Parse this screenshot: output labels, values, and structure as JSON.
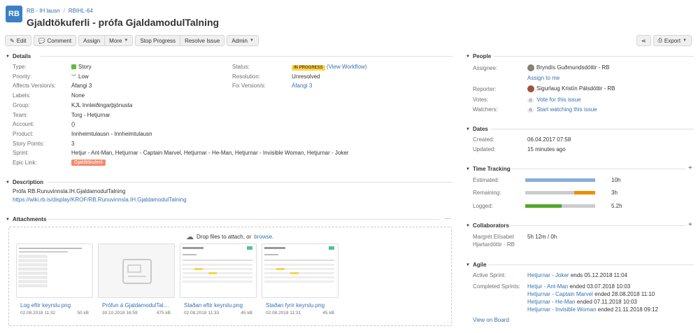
{
  "header": {
    "project_avatar": "RB",
    "breadcrumb_project": "RB - IH lausn",
    "breadcrumb_issue": "RBIHL-64",
    "title": "Gjaldtökuferli - prófa GjaldamodulTalning"
  },
  "toolbar": {
    "edit": "Edit",
    "comment": "Comment",
    "assign": "Assign",
    "more": "More",
    "stop_progress": "Stop Progress",
    "resolve_issue": "Resolve Issue",
    "admin": "Admin",
    "export": "Export"
  },
  "details": {
    "heading": "Details",
    "type_label": "Type:",
    "type_value": "Story",
    "priority_label": "Priority:",
    "priority_value": "Low",
    "affects_label": "Affects Version/s:",
    "affects_value": "Áfangi 3",
    "labels_label": "Labels:",
    "labels_value": "None",
    "group_label": "Group:",
    "group_value": "KJL Innleiðingarþjónusta",
    "team_label": "Team:",
    "team_value": "Torg - Hetjurnar",
    "account_label": "Account:",
    "account_value": "()",
    "product_label": "Product:",
    "product_value": "Innheimtulausn - Innheimtulausn",
    "points_label": "Story Points:",
    "points_value": "3",
    "sprint_label": "Sprint:",
    "sprint_value": "Hetjur - Ant-Man, Hetjurnar - Captain Marvel, Hetjurnar - He-Man, Hetjurnar - Invisible Woman, Hetjurnar - Joker",
    "epic_label": "Epic Link:",
    "epic_value": "Gjaldtökuferli",
    "status_label": "Status:",
    "status_value": "IN PROGRESS",
    "workflow_link": "(View Workflow)",
    "resolution_label": "Resolution:",
    "resolution_value": "Unresolved",
    "fix_label": "Fix Version/s:",
    "fix_value": "Áfangi 3"
  },
  "description": {
    "heading": "Description",
    "line1": "Prófa RB.Runuvinnsla.IH.GjaldamodulTalning",
    "link": "https://wiki.rb.is/display/KROF/RB.Runuvinnsla.IH.GjaldamodulTalning"
  },
  "attachments": {
    "heading": "Attachments",
    "drop_text": "Drop files to attach, or",
    "browse": "browse.",
    "files": [
      {
        "name": "Log eftir keyrslu.png",
        "date": "02.08.2018 11:32",
        "size": "50 kB"
      },
      {
        "name": "Prófun á GjaldamodulTalning",
        "date": "30.10.2018 16:59",
        "size": "475 kB"
      },
      {
        "name": "Staðan eftir keyrslu.png",
        "date": "02.08.2018 11:33",
        "size": "45 kB"
      },
      {
        "name": "Staðan fyrir keyrslu.png",
        "date": "02.08.2018 11:31",
        "size": "45 kB"
      }
    ]
  },
  "people": {
    "heading": "People",
    "assignee_label": "Assignee:",
    "assignee_value": "Bryndís Guðmundsdóttir - RB",
    "assign_to_me": "Assign to me",
    "reporter_label": "Reporter:",
    "reporter_value": "Sigurlaug Kristín Pálsdóttir - RB",
    "votes_label": "Votes:",
    "votes_count": "0",
    "votes_link": "Vote for this issue",
    "watchers_label": "Watchers:",
    "watchers_count": "0",
    "watchers_link": "Start watching this issue"
  },
  "dates": {
    "heading": "Dates",
    "created_label": "Created:",
    "created_value": "06.04.2017 07:58",
    "updated_label": "Updated:",
    "updated_value": "15 minutes ago"
  },
  "time_tracking": {
    "heading": "Time Tracking",
    "estimated_label": "Estimated:",
    "estimated_value": "10h",
    "estimated_fraction": 1.0,
    "remaining_label": "Remaining:",
    "remaining_value": "3h",
    "remaining_fraction": 0.3,
    "logged_label": "Logged:",
    "logged_value": "5.2h",
    "logged_fraction": 0.52,
    "estimated_color": "#89afd7",
    "remaining_color": "#ec8e00",
    "logged_color": "#51a825"
  },
  "collaborators": {
    "heading": "Collaborators",
    "name_line1": "Margrét Elísabet",
    "name_line2": "Hjartardóttir - RB",
    "time": "5h 12m / 0h"
  },
  "agile": {
    "heading": "Agile",
    "active_label": "Active Sprint:",
    "active_sprint": "Hetjurnar - Joker",
    "active_suffix": "ends 05.12.2018 11:04",
    "completed_label": "Completed Sprints:",
    "completed": [
      {
        "team": "Hetjur",
        "name": "Ant-Man",
        "suffix": "ended 03.07.2018 10:03"
      },
      {
        "team": "Hetjurnar",
        "name": "Captain Marvel",
        "suffix": "ended 28.08.2018 11:10"
      },
      {
        "team": "Hetjurnar",
        "name": "He-Man",
        "suffix": "ended 07.11.2018 10:03"
      },
      {
        "team": "Hetjurnar",
        "name": "Invisible Woman",
        "suffix": "ended 21.11.2018 09:12"
      }
    ],
    "view_on_board": "View on Board"
  }
}
